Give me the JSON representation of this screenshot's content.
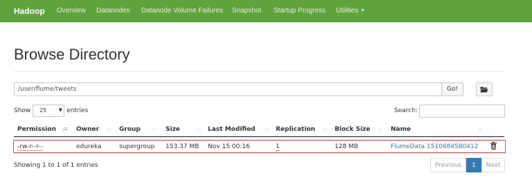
{
  "navbar": {
    "brand": "Hadoop",
    "items": [
      "Overview",
      "Datanodes",
      "Datanode Volume Failures",
      "Snapshot",
      "Startup Progress",
      "Utilities"
    ],
    "bg_color": "#5fa33e"
  },
  "page": {
    "title": "Browse Directory"
  },
  "path_bar": {
    "value": "/user/flume/tweets",
    "go_label": "Go!",
    "folder_icon": "folder-open-icon"
  },
  "length_control": {
    "show_label": "Show",
    "selected": "25",
    "entries_label": "entries"
  },
  "search": {
    "label": "Search:",
    "value": ""
  },
  "table": {
    "columns": [
      "Permission",
      "Owner",
      "Group",
      "Size",
      "Last Modified",
      "Replication",
      "Block Size",
      "Name"
    ],
    "rows": [
      {
        "permission": "-rw-r--r--",
        "owner": "edureka",
        "group": "supergroup",
        "size": "153.37 MB",
        "last_modified": "Nov 15 00:16",
        "replication": "1",
        "block_size": "128 MB",
        "name": "FlumeData.1510684580412",
        "action_icon": "trash-icon"
      }
    ],
    "highlight_color": "#e0464b"
  },
  "footer": {
    "info": "Showing 1 to 1 of 1 entries",
    "pagination": {
      "previous": "Previous",
      "current": "1",
      "next": "Next"
    }
  }
}
